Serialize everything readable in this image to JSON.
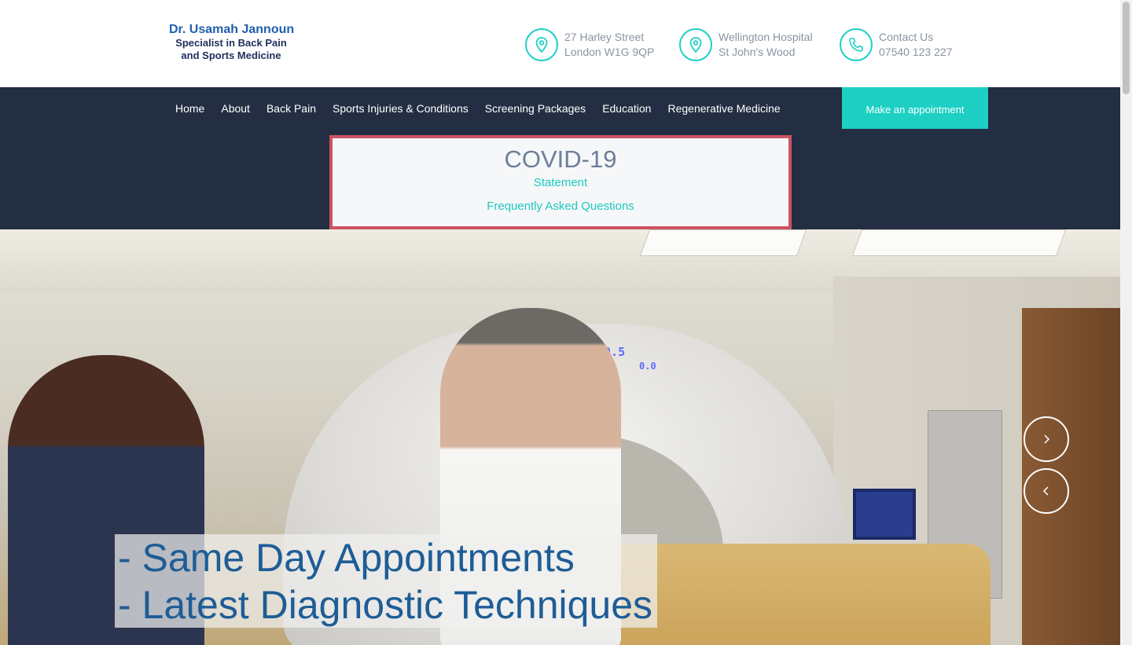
{
  "brand": {
    "name": "Dr. Usamah Jannoun",
    "tagline_line1": "Specialist in Back Pain",
    "tagline_line2": "and Sports Medicine"
  },
  "header_info": [
    {
      "icon": "location-pin-icon",
      "line1": "27 Harley Street",
      "line2": "London W1G 9QP"
    },
    {
      "icon": "location-pin-icon",
      "line1": "Wellington Hospital",
      "line2": "St John's Wood"
    },
    {
      "icon": "phone-icon",
      "line1": "Contact Us",
      "line2": "07540 123 227"
    }
  ],
  "nav": {
    "items": [
      "Home",
      "About",
      "Back Pain",
      "Sports Injuries & Conditions",
      "Screening Packages",
      "Education",
      "Regenerative Medicine"
    ],
    "cta": "Make an appointment"
  },
  "covid": {
    "title": "COVID-19",
    "statement": "Statement",
    "faq": "Frequently Asked Questions"
  },
  "hero": {
    "caption_line1": "- Same Day Appointments",
    "caption_line2": "- Latest Diagnostic Techniques",
    "scanner_display1": "169.5",
    "scanner_display2": "0.0"
  },
  "colors": {
    "accent": "#1ecfc4",
    "nav_bg": "#232e43",
    "covid_border": "#cd5264",
    "caption_text": "#1e5d96"
  }
}
